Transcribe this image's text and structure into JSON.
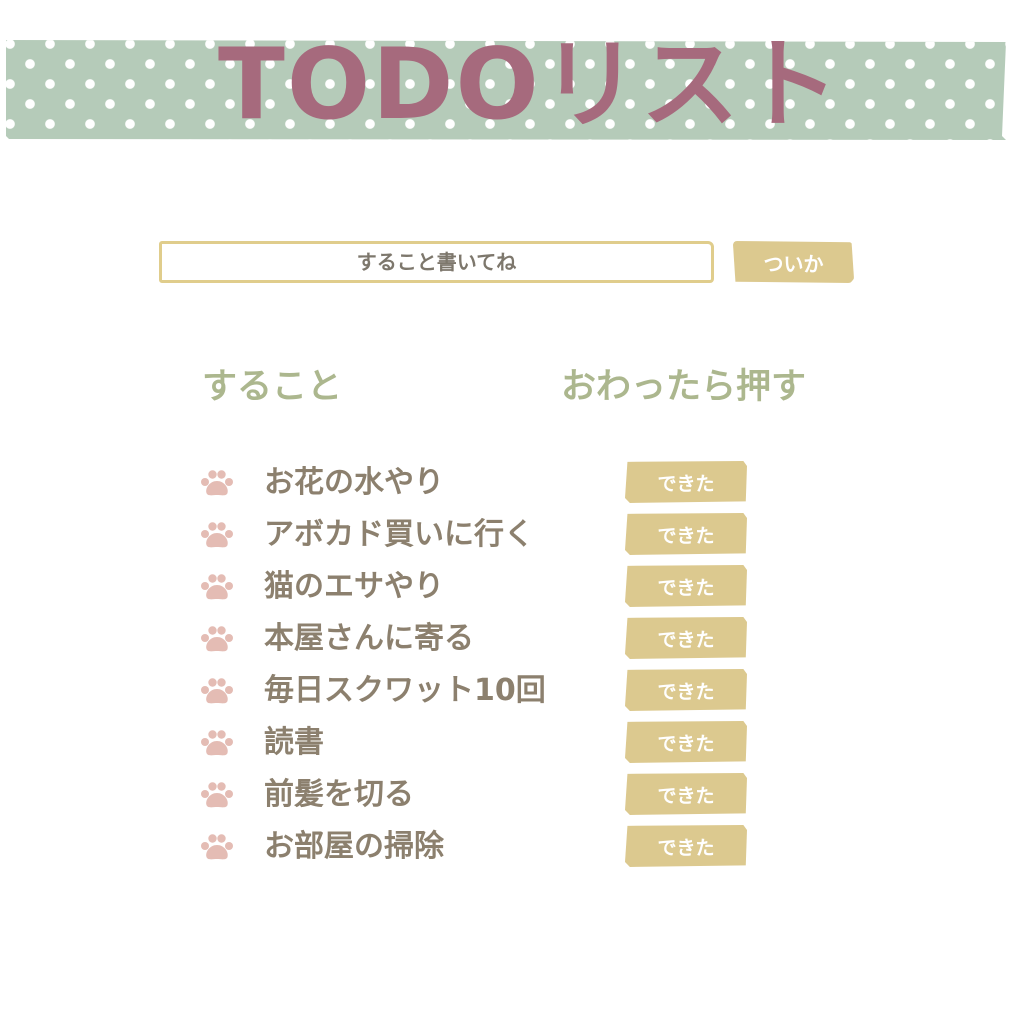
{
  "header": {
    "title": "TODOリスト"
  },
  "input": {
    "placeholder": "すること書いてね",
    "value": ""
  },
  "add_button": {
    "label": "ついか"
  },
  "columns": {
    "todo_heading": "すること",
    "done_heading": "おわったら押す"
  },
  "items": [
    {
      "icon": "paw-icon",
      "text": "お花の水やり",
      "button_label": "できた"
    },
    {
      "icon": "paw-icon",
      "text": "アボカド買いに行く",
      "button_label": "できた"
    },
    {
      "icon": "paw-icon",
      "text": "猫のエサやり",
      "button_label": "できた"
    },
    {
      "icon": "paw-icon",
      "text": "本屋さんに寄る",
      "button_label": "できた"
    },
    {
      "icon": "paw-icon",
      "text": "毎日スクワット10回",
      "button_label": "できた"
    },
    {
      "icon": "paw-icon",
      "text": "読書",
      "button_label": "できた"
    },
    {
      "icon": "paw-icon",
      "text": "前髪を切る",
      "button_label": "できた"
    },
    {
      "icon": "paw-icon",
      "text": "お部屋の掃除",
      "button_label": "できた"
    }
  ],
  "colors": {
    "banner_bg": "#b5cbb9",
    "title": "#a66a7d",
    "accent": "#dcc98f",
    "heading": "#acb78e",
    "item_text": "#8c806e",
    "paw": "#e4bcb4"
  }
}
